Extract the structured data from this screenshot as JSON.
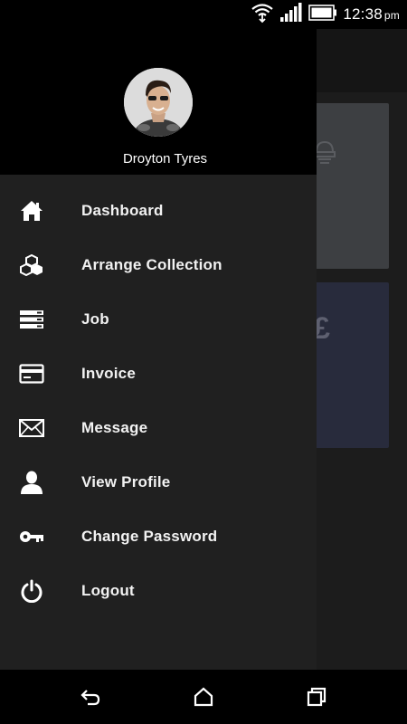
{
  "status_bar": {
    "time": "12:38",
    "ampm": "pm",
    "icons": [
      "wifi-icon",
      "signal-icon",
      "battery-icon"
    ]
  },
  "background": {
    "card2_symbol": "£",
    "colors": {
      "app": "#1c1c1c",
      "card1": "#3d3f42",
      "card2": "#282b3c"
    }
  },
  "drawer": {
    "user_name": "Droyton Tyres",
    "menu": [
      {
        "label": "Dashboard",
        "icon": "home-icon"
      },
      {
        "label": "Arrange Collection",
        "icon": "boxes-icon"
      },
      {
        "label": "Job",
        "icon": "list-icon"
      },
      {
        "label": "Invoice",
        "icon": "credit-card-icon"
      },
      {
        "label": "Message",
        "icon": "envelope-icon"
      },
      {
        "label": "View Profile",
        "icon": "person-icon"
      },
      {
        "label": "Change Password",
        "icon": "key-icon"
      },
      {
        "label": "Logout",
        "icon": "power-icon"
      }
    ]
  },
  "nav_bar": {
    "buttons": [
      "back-icon",
      "home-nav-icon",
      "recents-icon"
    ]
  },
  "colors": {
    "drawer": "#202020",
    "header": "#000000",
    "text": "#f2f2f2"
  }
}
